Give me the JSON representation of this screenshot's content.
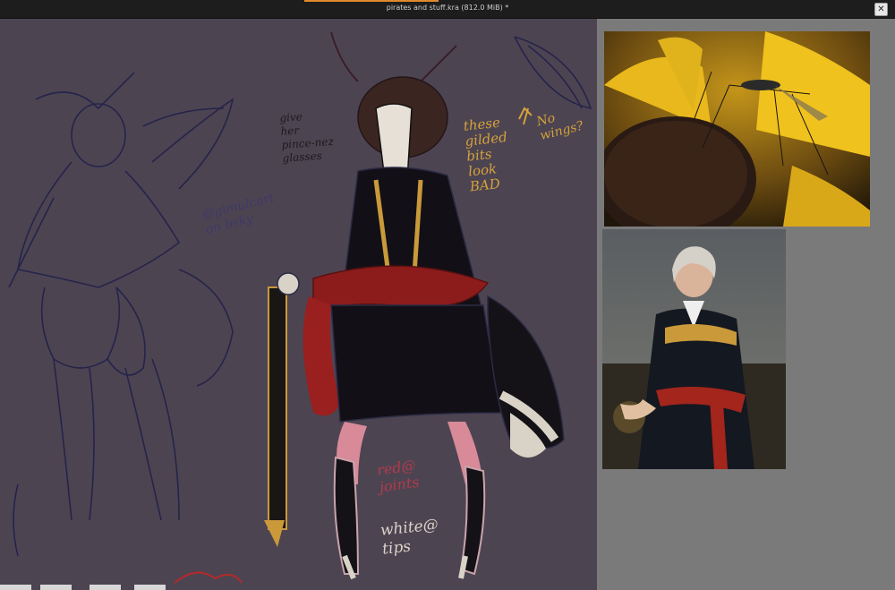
{
  "window": {
    "title": "pirates and stuff.kra (812.0 MiB) *",
    "close_glyph": "✕",
    "accent_color": "#e08a2c"
  },
  "canvas": {
    "background": "#4d4452",
    "notes": {
      "pince_nez": "give\nher\npince-nez\nglasses",
      "signature": "@gimulcart\non bsky",
      "gilded": "these\ngilded\nbits\nlook\nBAD",
      "no_wings": "No\nwings?",
      "red_joints": "red@\njoints",
      "white_tips": "white@\ntips"
    }
  },
  "references": [
    {
      "name": "mosquito-on-flower-photo"
    },
    {
      "name": "admiral-portrait-painting"
    }
  ]
}
